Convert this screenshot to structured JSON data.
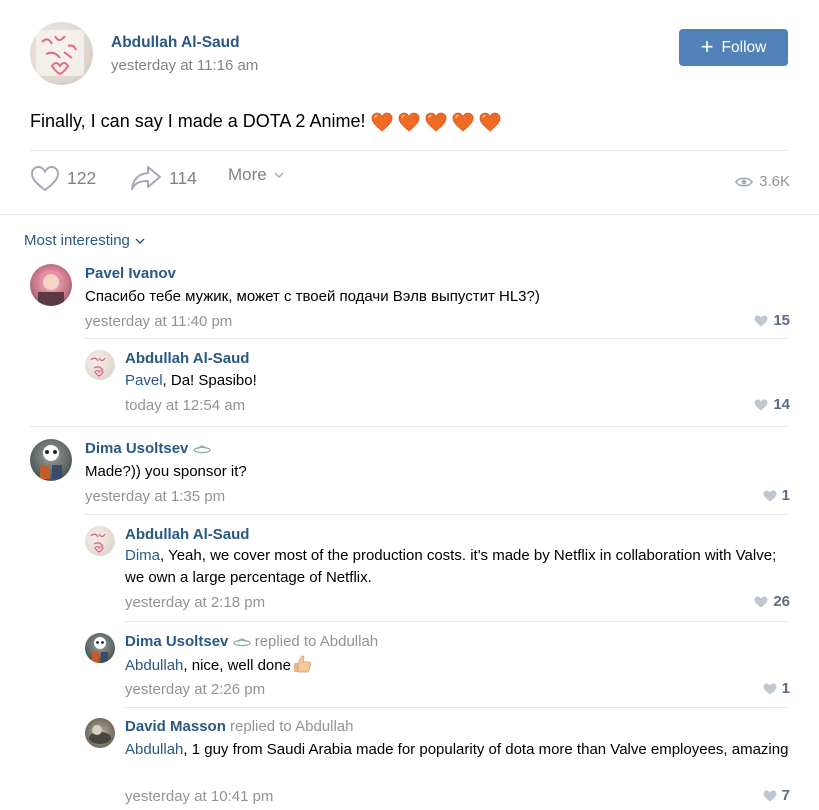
{
  "post": {
    "author": "Abdullah Al-Saud",
    "time": "yesterday at 11:16 am",
    "follow_label": "Follow",
    "text": "Finally, I can say I made a DOTA 2 Anime!",
    "emoji_count": 5,
    "likes": "122",
    "shares": "114",
    "more_label": "More",
    "views": "3.6K"
  },
  "sort_label": "Most interesting",
  "comments": [
    {
      "author": "Pavel Ivanov",
      "text": "Спасибо тебе мужик, может с твоей подачи Вэлв выпустит HL3?)",
      "time": "yesterday at 11:40 pm",
      "likes": "15"
    },
    {
      "author": "Abdullah Al-Saud",
      "mention": "Pavel",
      "text": ", Da! Spasibo!",
      "time": "today at 12:54 am",
      "likes": "14"
    },
    {
      "author": "Dima Usoltsev",
      "text": "Made?)) you sponsor it?",
      "time": "yesterday at 1:35 pm",
      "likes": "1"
    },
    {
      "author": "Abdullah Al-Saud",
      "mention": "Dima",
      "text": ", Yeah, we cover most of the production costs. it's made by Netflix in collaboration with Valve; we own a large percentage of Netflix.",
      "time": "yesterday at 2:18 pm",
      "likes": "26"
    },
    {
      "author": "Dima Usoltsev",
      "replied": "replied to Abdullah",
      "mention": "Abdullah",
      "text": ", nice, well done",
      "time": "yesterday at 2:26 pm",
      "likes": "1"
    },
    {
      "author": "David Masson",
      "replied": "replied to Abdullah",
      "mention": "Abdullah",
      "text": ", 1 guy from Saudi Arabia made for popularity of dota more than Valve employees, amazing",
      "time": "yesterday at 10:41 pm",
      "likes": "7"
    }
  ],
  "colors": {
    "link": "#2a5885",
    "button": "#5181b8",
    "muted": "#939393"
  }
}
